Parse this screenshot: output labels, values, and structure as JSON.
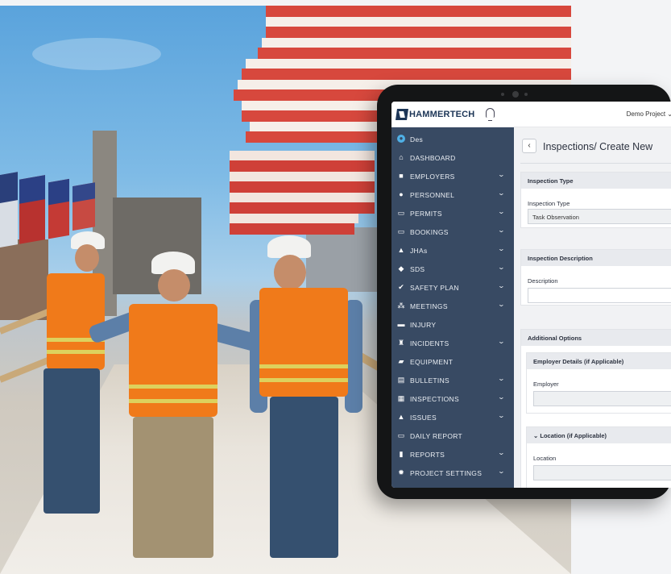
{
  "app": {
    "brand_name": "HAMMERTECH",
    "project_selector": "Demo Project",
    "colors": {
      "sidebar": "#384a63",
      "brand": "#1c3556",
      "vest": "#f07a1a"
    }
  },
  "sidebar": {
    "user": {
      "name": "Des",
      "icon": "user-circle-icon"
    },
    "items": [
      {
        "label": "DASHBOARD",
        "icon": "home-icon",
        "expandable": false
      },
      {
        "label": "EMPLOYERS",
        "icon": "briefcase-icon",
        "expandable": true
      },
      {
        "label": "PERSONNEL",
        "icon": "person-icon",
        "expandable": true
      },
      {
        "label": "PERMITS",
        "icon": "card-icon",
        "expandable": true
      },
      {
        "label": "BOOKINGS",
        "icon": "card-icon",
        "expandable": true
      },
      {
        "label": "JHAs",
        "icon": "hazard-icon",
        "expandable": true
      },
      {
        "label": "SDS",
        "icon": "diamond-icon",
        "expandable": true
      },
      {
        "label": "SAFETY PLAN",
        "icon": "check-circle-icon",
        "expandable": true
      },
      {
        "label": "MEETINGS",
        "icon": "group-icon",
        "expandable": true
      },
      {
        "label": "INJURY",
        "icon": "bandage-icon",
        "expandable": false
      },
      {
        "label": "INCIDENTS",
        "icon": "alert-light-icon",
        "expandable": true
      },
      {
        "label": "EQUIPMENT",
        "icon": "truck-icon",
        "expandable": false
      },
      {
        "label": "BULLETINS",
        "icon": "document-icon",
        "expandable": true
      },
      {
        "label": "INSPECTIONS",
        "icon": "clipboard-icon",
        "expandable": true
      },
      {
        "label": "ISSUES",
        "icon": "warning-icon",
        "expandable": true
      },
      {
        "label": "DAILY REPORT",
        "icon": "calendar-icon",
        "expandable": false
      },
      {
        "label": "REPORTS",
        "icon": "report-icon",
        "expandable": true
      },
      {
        "label": "PROJECT SETTINGS",
        "icon": "gear-icon",
        "expandable": true
      }
    ]
  },
  "main": {
    "breadcrumb_section": "Inspections",
    "breadcrumb_page": "/ Create New",
    "inspection_type": {
      "header": "Inspection Type",
      "field_label": "Inspection Type",
      "value": "Task Observation"
    },
    "description": {
      "header": "Inspection Description",
      "field_label": "Description",
      "value": ""
    },
    "additional": {
      "header": "Additional Options",
      "employer_section": {
        "header": "Employer Details (if Applicable)",
        "field_label": "Employer",
        "value": ""
      },
      "location_section": {
        "header": "Location (if Applicable)",
        "field_label": "Location",
        "value": ""
      }
    }
  }
}
